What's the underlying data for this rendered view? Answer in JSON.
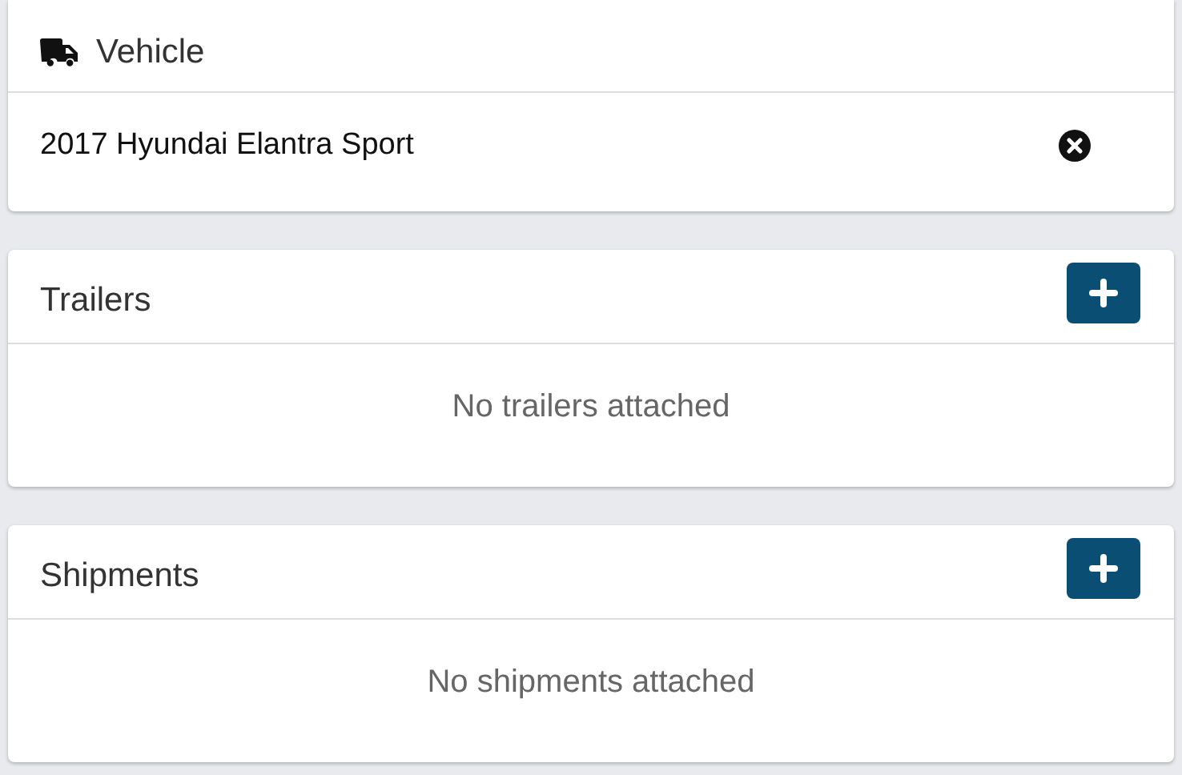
{
  "vehicle": {
    "title": "Vehicle",
    "selected_vehicle": "2017 Hyundai Elantra Sport"
  },
  "sections": [
    {
      "title": "Trailers",
      "empty_text": "No trailers attached"
    },
    {
      "title": "Shipments",
      "empty_text": "No shipments attached"
    }
  ]
}
